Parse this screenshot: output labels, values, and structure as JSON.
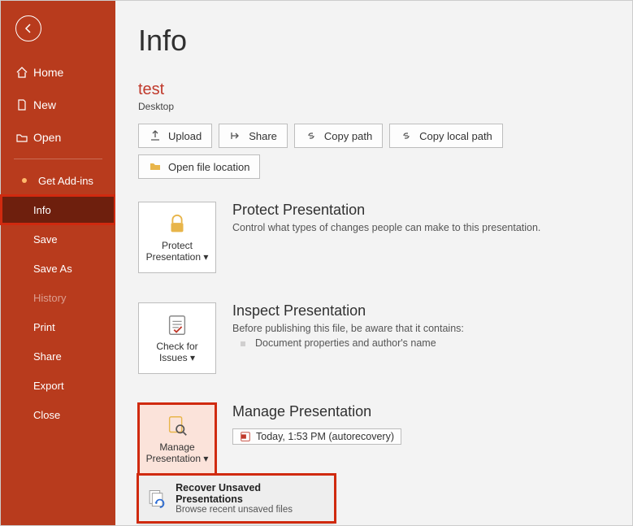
{
  "sidebar": {
    "home": "Home",
    "new": "New",
    "open": "Open",
    "addins": "Get Add-ins",
    "info": "Info",
    "save": "Save",
    "saveas": "Save As",
    "history": "History",
    "print": "Print",
    "share": "Share",
    "export": "Export",
    "close": "Close"
  },
  "page": {
    "title": "Info",
    "doc_name": "test",
    "doc_location": "Desktop"
  },
  "actions": {
    "upload": "Upload",
    "share": "Share",
    "copypath": "Copy path",
    "copylocal": "Copy local path",
    "openloc": "Open file location"
  },
  "protect": {
    "btn": "Protect Presentation",
    "heading": "Protect Presentation",
    "text": "Control what types of changes people can make to this presentation."
  },
  "inspect": {
    "btn": "Check for Issues",
    "heading": "Inspect Presentation",
    "text": "Before publishing this file, be aware that it contains:",
    "item1": "Document properties and author's name"
  },
  "manage": {
    "btn": "Manage Presentation",
    "heading": "Manage Presentation",
    "chip": "Today, 1:53 PM (autorecovery)",
    "menu_title": "Recover Unsaved Presentations",
    "menu_sub": "Browse recent unsaved files"
  }
}
